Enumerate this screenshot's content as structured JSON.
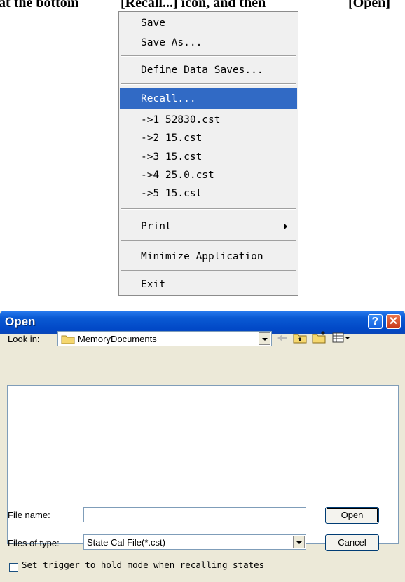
{
  "top_text": {
    "left": "at the bottom",
    "middle": "[Recall...] icon, and then",
    "right": "[Open]"
  },
  "menu": {
    "items": [
      {
        "label": "Save"
      },
      {
        "label": "Save As..."
      },
      {
        "label": "Define Data Saves..."
      },
      {
        "label": "Recall...",
        "selected": true
      },
      {
        "label": "->1 52830.cst"
      },
      {
        "label": "->2 15.cst"
      },
      {
        "label": "->3 15.cst"
      },
      {
        "label": "->4 25.0.cst"
      },
      {
        "label": "->5 15.cst"
      },
      {
        "label": "Print",
        "submenu": true
      },
      {
        "label": "Minimize Application"
      },
      {
        "label": "Exit"
      }
    ]
  },
  "dialog": {
    "title": "Open",
    "help_glyph": "?",
    "close_glyph": "✕",
    "look_in_label": "Look in:",
    "look_in_value": "MemoryDocuments",
    "file_name_label": "File name:",
    "file_name_value": "",
    "files_of_type_label": "Files of type:",
    "files_of_type_value": "State Cal File(*.cst)",
    "open_button": "Open",
    "cancel_button": "Cancel",
    "checkbox_label": "Set trigger to hold mode when recalling states",
    "checkbox_checked": false
  },
  "colors": {
    "menu_highlight": "#316ac5",
    "titlebar": "#0a5ad4",
    "dialog_bg": "#ece9d8"
  },
  "icons": [
    "folder-icon",
    "back-arrow-icon",
    "up-folder-icon",
    "new-folder-icon",
    "view-menu-icon",
    "help-icon",
    "close-icon"
  ]
}
